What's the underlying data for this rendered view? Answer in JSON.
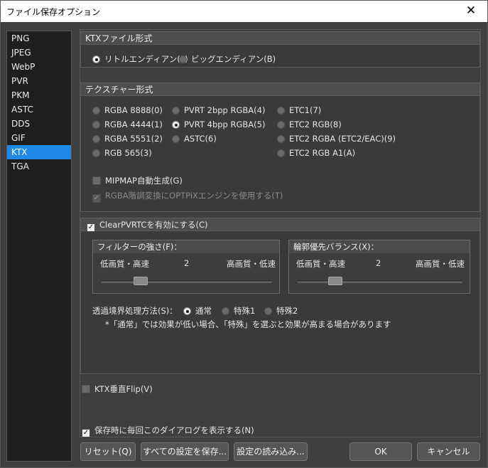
{
  "window": {
    "title": "ファイル保存オプション",
    "close_glyph": "✕"
  },
  "sidebar": {
    "items": [
      {
        "label": "PNG"
      },
      {
        "label": "JPEG"
      },
      {
        "label": "WebP"
      },
      {
        "label": "PVR"
      },
      {
        "label": "PKM"
      },
      {
        "label": "ASTC"
      },
      {
        "label": "DDS"
      },
      {
        "label": "GIF"
      },
      {
        "label": "KTX"
      },
      {
        "label": "TGA"
      }
    ],
    "selected": "KTX"
  },
  "ktx_format": {
    "header": "KTXファイル形式",
    "little_endian": "リトルエンディアン(L)",
    "big_endian": "ビッグエンディアン(B)",
    "selected": "little_endian"
  },
  "texture_format": {
    "header": "テクスチャー形式",
    "options": {
      "rgba8888": "RGBA 8888(0)",
      "rgba4444": "RGBA 4444(1)",
      "rgba5551": "RGBA 5551(2)",
      "rgb565": "RGB 565(3)",
      "pvrt2": "PVRT 2bpp RGBA(4)",
      "pvrt4": "PVRT 4bpp RGBA(5)",
      "astc": "ASTC(6)",
      "etc1": "ETC1(7)",
      "etc2rgb": "ETC2 RGB(8)",
      "etc2rgba": "ETC2 RGBA (ETC2/EAC)(9)",
      "etc2rgba1": "ETC2 RGB A1(A)"
    },
    "selected": "pvrt4",
    "mipmap_label": "MIPMAP自動生成(G)",
    "mipmap_checked": false,
    "optpix_label": "RGBA階調変換にOPTPiXエンジンを使用する(T)",
    "optpix_checked": true,
    "optpix_disabled": true
  },
  "clear_pvrtc": {
    "label": "ClearPVRTCを有効にする(C)",
    "checked": true,
    "filter": {
      "header": "フィルターの強さ(F)：",
      "left": "低画質・高速",
      "value": "2",
      "right": "高画質・低速",
      "level_fraction": 0.25
    },
    "outline": {
      "header": "輪郭優先バランス(X)：",
      "left": "低画質・高速",
      "value": "2",
      "right": "高画質・低速",
      "level_fraction": 0.25
    },
    "transparent_label": "透過境界処理方法(S)：",
    "transparent_options": {
      "normal": "通常",
      "special1": "特殊1",
      "special2": "特殊2"
    },
    "transparent_selected": "normal",
    "note": "*「通常」では効果が低い場合、「特殊」を選ぶと効果が高まる場合があります"
  },
  "ktx_flip": {
    "label": "KTX垂直Flip(V)",
    "checked": false
  },
  "show_dialog": {
    "label": "保存時に毎回このダイアログを表示する(N)",
    "checked": true
  },
  "buttons": {
    "reset": "リセット(Q)",
    "save_all": "すべての設定を保存...",
    "load": "設定の読み込み...",
    "ok": "OK",
    "cancel": "キャンセル"
  },
  "colors": {
    "accent": "#1e88e5",
    "background": "#3f3f3f"
  }
}
